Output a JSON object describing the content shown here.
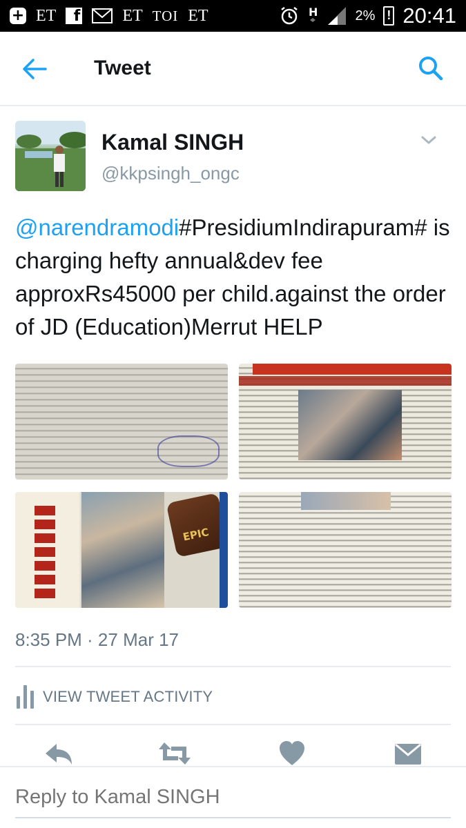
{
  "status_bar": {
    "left_items": [
      "ET",
      "ET",
      "TOI",
      "ET"
    ],
    "battery_percent": "2%",
    "time": "20:41"
  },
  "header": {
    "title": "Tweet",
    "back_icon": "arrow-left-icon",
    "search_icon": "search-icon",
    "accent_color": "#1da1f2"
  },
  "tweet": {
    "author_name": "Kamal SINGH",
    "author_handle": "@kkpsingh_ongc",
    "mention": "@narendramodi",
    "text": "#PresidiumIndirapuram# is charging hefty annual&dev fee approxRs45000 per child.against the order of JD (Education)Merrut HELP",
    "timestamp": "8:35 PM · 27 Mar 17",
    "media_count": 4,
    "media_labels": [
      "EPIC"
    ]
  },
  "activity": {
    "label": "VIEW TWEET ACTIVITY"
  },
  "actions": {
    "icons": [
      "reply-icon",
      "retweet-icon",
      "like-icon",
      "message-icon"
    ],
    "icon_color": "#8899a6"
  },
  "reply": {
    "placeholder": "Reply to Kamal SINGH"
  }
}
